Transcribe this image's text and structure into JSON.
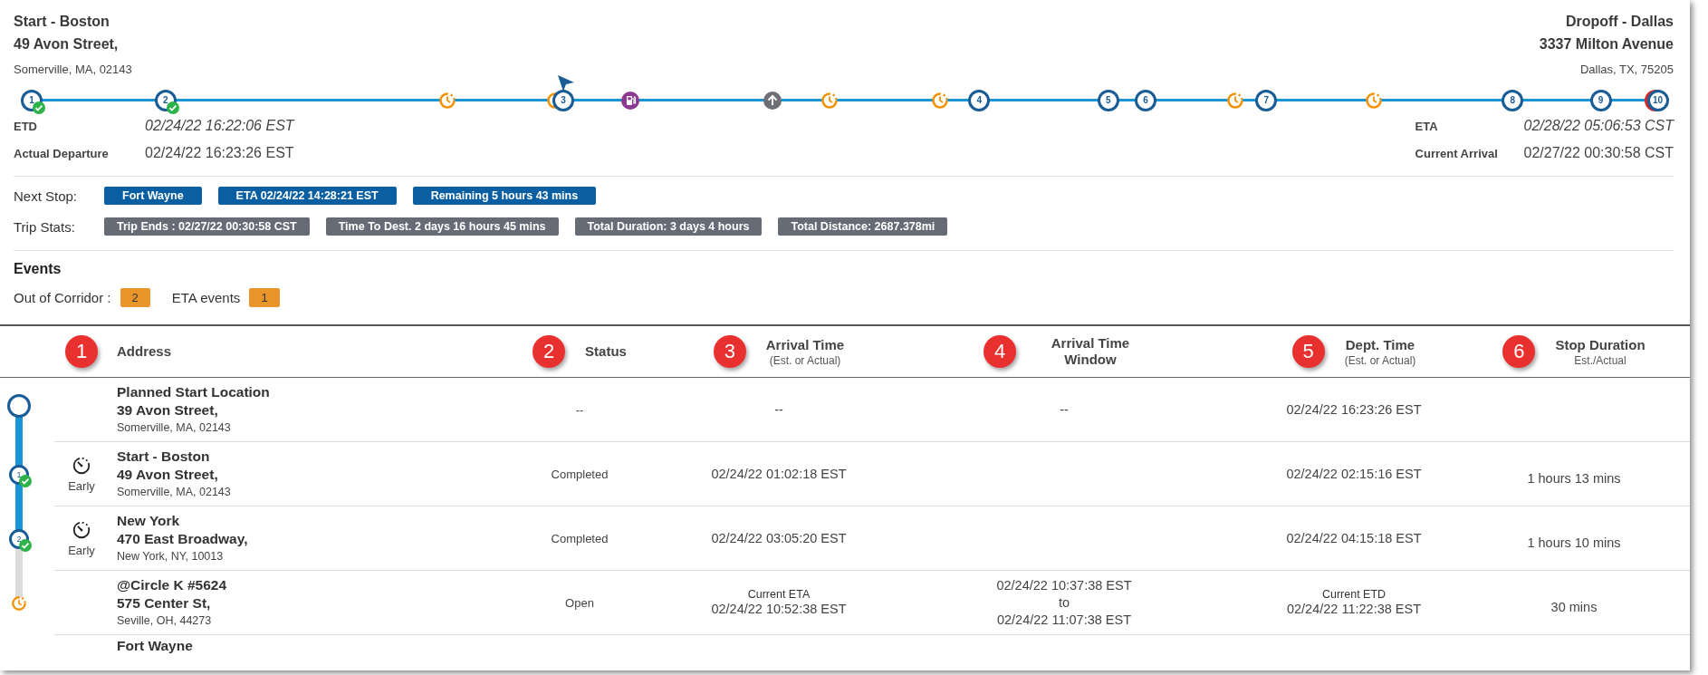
{
  "origin": {
    "title": "Start - Boston",
    "street": "49 Avon Street,",
    "city": "Somerville, MA, 02143"
  },
  "destination": {
    "title": "Dropoff - Dallas",
    "street": "3337 Milton Avenue",
    "city": "Dallas, TX, 75205"
  },
  "timeline": {
    "markers": [
      {
        "kind": "stop",
        "label": "1",
        "completed": true
      },
      {
        "kind": "stop",
        "label": "2",
        "completed": true
      },
      {
        "kind": "clock"
      },
      {
        "kind": "clock"
      },
      {
        "kind": "stop",
        "label": "3",
        "completed": false
      },
      {
        "kind": "fuel"
      },
      {
        "kind": "arrow"
      },
      {
        "kind": "clock"
      },
      {
        "kind": "clock"
      },
      {
        "kind": "stop",
        "label": "4",
        "completed": false
      },
      {
        "kind": "stop",
        "label": "5",
        "completed": false
      },
      {
        "kind": "stop",
        "label": "6",
        "completed": false
      },
      {
        "kind": "clock"
      },
      {
        "kind": "stop",
        "label": "7",
        "completed": false
      },
      {
        "kind": "clock"
      },
      {
        "kind": "stop",
        "label": "8",
        "completed": false
      },
      {
        "kind": "stop",
        "label": "9",
        "completed": false
      },
      {
        "kind": "destination",
        "label": "10",
        "completed": false
      }
    ]
  },
  "departure_times": [
    {
      "label": "ETD",
      "value": "02/24/22 16:22:06 EST",
      "kind": "estimate"
    },
    {
      "label": "Actual Departure",
      "value": "02/24/22 16:23:26 EST",
      "kind": "actual"
    }
  ],
  "arrival_times": [
    {
      "label": "ETA",
      "value": "02/28/22 05:06:53 CST",
      "kind": "estimate"
    },
    {
      "label": "Current Arrival",
      "value": "02/27/22 00:30:58 CST",
      "kind": "actual"
    }
  ],
  "next_stop": {
    "label": "Next Stop:",
    "badges": [
      "Fort Wayne",
      "ETA 02/24/22 14:28:21 EST",
      "Remaining 5 hours 43 mins"
    ]
  },
  "trip_stats": {
    "label": "Trip Stats:",
    "badges": [
      "Trip Ends : 02/27/22 00:30:58 CST",
      "Time To Dest. 2 days 16 hours 45 mins",
      "Total Duration: 3 days 4 hours",
      "Total Distance: 2687.378mi"
    ]
  },
  "events": {
    "title": "Events",
    "items": [
      {
        "label": "Out of Corridor :",
        "count": "2"
      },
      {
        "label": "ETA events",
        "count": "1"
      }
    ]
  },
  "table": {
    "columns": [
      {
        "annotation": "1"
      },
      {
        "label": "Address"
      },
      {
        "label": "Status",
        "annotation": "2"
      },
      {
        "label": "Arrival Time",
        "sub": "(Est. or Actual)",
        "annotation": "3"
      },
      {
        "label": "Arrival Time Window",
        "annotation": "4"
      },
      {
        "label": "Dept. Time",
        "sub": "(Est. or Actual)",
        "annotation": "5"
      },
      {
        "label": "Stop Duration",
        "sub": "Est./Actual",
        "annotation": "6"
      }
    ],
    "rows": [
      {
        "marker": {
          "kind": "start"
        },
        "name": "Planned Start Location",
        "street": "39 Avon Street,",
        "city": "Somerville, MA, 02143",
        "status": "--",
        "arrival": {
          "value": "--"
        },
        "window": [
          "--"
        ],
        "departure": {
          "value": "02/24/22 16:23:26 EST"
        }
      },
      {
        "marker": {
          "kind": "stop",
          "label": "1",
          "completed": true
        },
        "timing": "Early",
        "name": "Start - Boston",
        "street": "49 Avon Street,",
        "city": "Somerville, MA, 02143",
        "status": "Completed",
        "arrival": {
          "value": "02/24/22 01:02:18 EST"
        },
        "departure": {
          "value": "02/24/22 02:15:16 EST"
        },
        "duration": "1 hours 13 mins"
      },
      {
        "marker": {
          "kind": "stop",
          "label": "2",
          "completed": true
        },
        "timing": "Early",
        "name": "New York",
        "street": "470 East Broadway,",
        "city": "New York, NY, 10013",
        "status": "Completed",
        "arrival": {
          "value": "02/24/22 03:05:20 EST"
        },
        "departure": {
          "value": "02/24/22 04:15:18 EST"
        },
        "duration": "1 hours 10 mins"
      },
      {
        "marker": {
          "kind": "clock"
        },
        "name": "@Circle K #5624",
        "street": "575 Center St,",
        "city": "Seville, OH, 44273",
        "status": "Open",
        "arrival": {
          "note": "Current ETA",
          "value": "02/24/22 10:52:38 EST"
        },
        "window": [
          "02/24/22 10:37:38 EST",
          "to",
          "02/24/22 11:07:38 EST"
        ],
        "departure": {
          "note": "Current ETD",
          "value": "02/24/22 11:22:38 EST"
        },
        "duration": "30 mins"
      },
      {
        "name": "Fort Wayne"
      }
    ]
  }
}
